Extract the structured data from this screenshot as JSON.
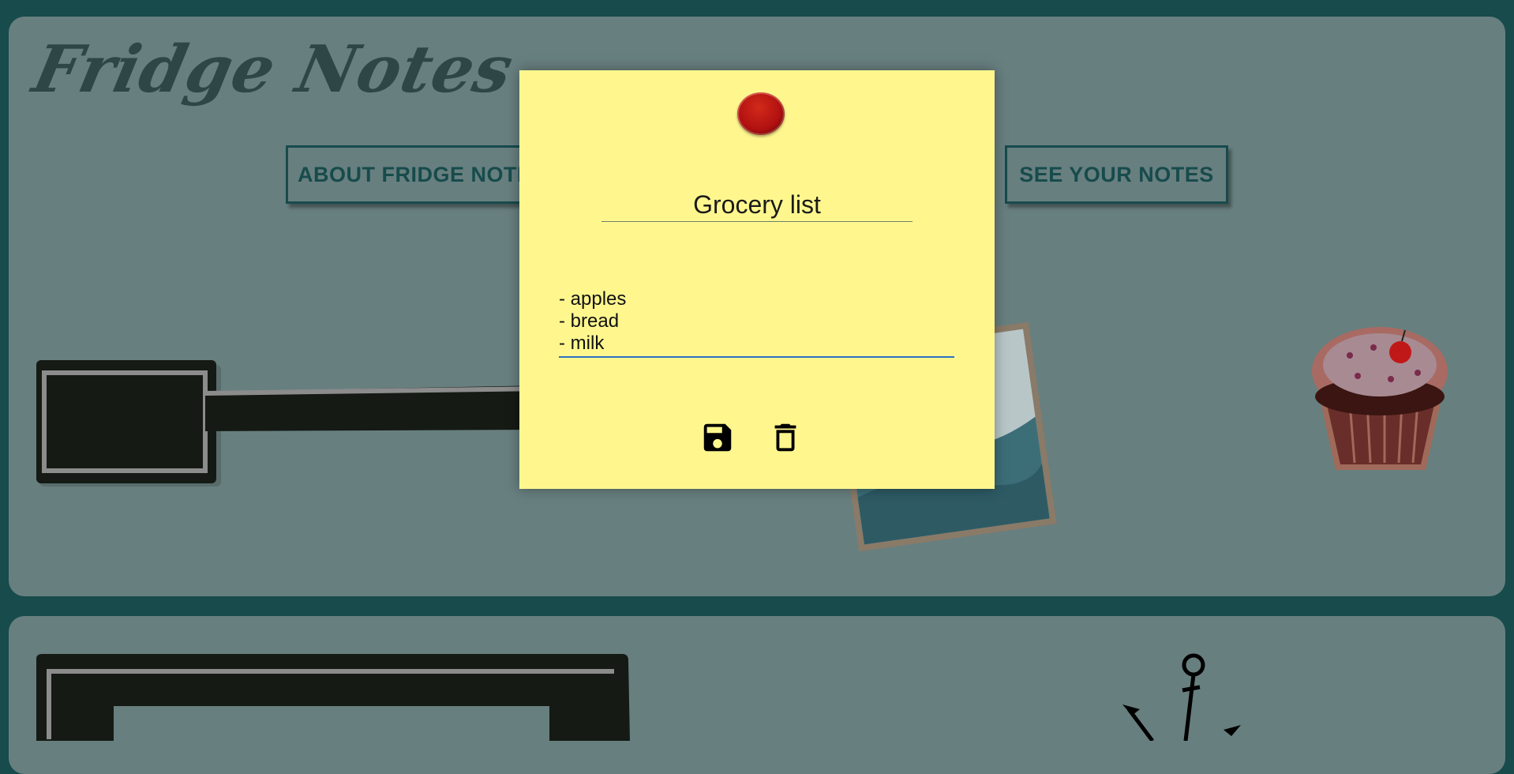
{
  "app": {
    "title": "Fridge Notes"
  },
  "nav": {
    "about_label": "ABOUT FRIDGE NOTES",
    "see_notes_label": "SEE YOUR NOTES"
  },
  "note": {
    "title": "Grocery list",
    "body": "- apples\n- bread\n- milk",
    "actions": {
      "save_icon": "save-icon",
      "delete_icon": "trash-icon"
    }
  },
  "colors": {
    "background": "#174b4c",
    "fridge_door": "#687f7f",
    "note": "#fff78e",
    "pin": "#b01010",
    "accent_text": "#174b4c"
  }
}
